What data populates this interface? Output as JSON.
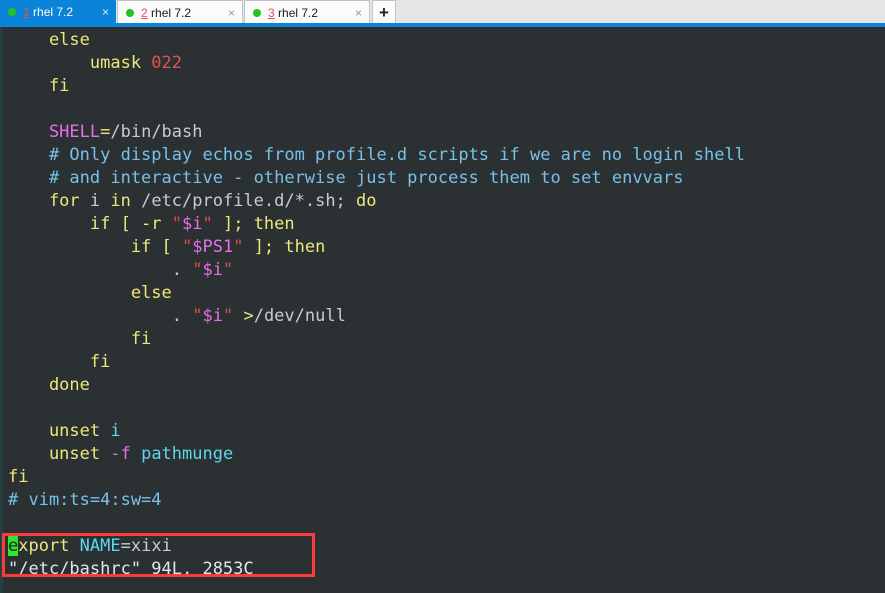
{
  "window": {
    "accent_color": "#0a84d8",
    "tabbar_bg": "#e6e6e6"
  },
  "tabs": {
    "items": [
      {
        "index": "1",
        "title": " rhel 7.2",
        "status_dot": "green-dot-icon",
        "close_label": "×",
        "active": true
      },
      {
        "index": "2",
        "title": " rhel 7.2",
        "status_dot": "green-dot-icon",
        "close_label": "×",
        "active": false
      },
      {
        "index": "3",
        "title": " rhel 7.2",
        "status_dot": "green-dot-icon",
        "close_label": "×",
        "active": false
      }
    ],
    "new_tab_label": "+"
  },
  "terminal": {
    "background": "#2b3033",
    "cursor_color": "#2ee62e",
    "file": "/etc/bashrc",
    "lines": [
      {
        "id": "l01",
        "segs": [
          {
            "t": "    else",
            "c": "kw"
          }
        ]
      },
      {
        "id": "l02",
        "segs": [
          {
            "t": "        umask ",
            "c": "kw"
          },
          {
            "t": "022",
            "c": "num"
          }
        ]
      },
      {
        "id": "l03",
        "segs": [
          {
            "t": "    fi",
            "c": "kw"
          }
        ]
      },
      {
        "id": "l04",
        "segs": [
          {
            "t": "",
            "c": "txt"
          }
        ]
      },
      {
        "id": "l05",
        "segs": [
          {
            "t": "    SHELL",
            "c": "var"
          },
          {
            "t": "=",
            "c": "op"
          },
          {
            "t": "/bin/bash",
            "c": "txt"
          }
        ]
      },
      {
        "id": "l06",
        "segs": [
          {
            "t": "    # Only display echos from profile.d scripts if we are no login shell",
            "c": "cmt"
          }
        ]
      },
      {
        "id": "l07",
        "segs": [
          {
            "t": "    # and interactive - otherwise just process them to set envvars",
            "c": "cmt"
          }
        ]
      },
      {
        "id": "l08",
        "segs": [
          {
            "t": "    for ",
            "c": "kw"
          },
          {
            "t": "i ",
            "c": "txt"
          },
          {
            "t": "in ",
            "c": "kw"
          },
          {
            "t": "/etc/profile.d/*.sh; ",
            "c": "txt"
          },
          {
            "t": "do",
            "c": "kw"
          }
        ]
      },
      {
        "id": "l09",
        "segs": [
          {
            "t": "        if [ -r ",
            "c": "kw"
          },
          {
            "t": "\"",
            "c": "str"
          },
          {
            "t": "$i",
            "c": "var"
          },
          {
            "t": "\"",
            "c": "str"
          },
          {
            "t": " ]; then",
            "c": "kw"
          }
        ]
      },
      {
        "id": "l10",
        "segs": [
          {
            "t": "            if [ ",
            "c": "kw"
          },
          {
            "t": "\"",
            "c": "str"
          },
          {
            "t": "$PS1",
            "c": "var"
          },
          {
            "t": "\"",
            "c": "str"
          },
          {
            "t": " ]; then",
            "c": "kw"
          }
        ]
      },
      {
        "id": "l11",
        "segs": [
          {
            "t": "                . ",
            "c": "txt"
          },
          {
            "t": "\"",
            "c": "str"
          },
          {
            "t": "$i",
            "c": "var"
          },
          {
            "t": "\"",
            "c": "str"
          }
        ]
      },
      {
        "id": "l12",
        "segs": [
          {
            "t": "            else",
            "c": "kw"
          }
        ]
      },
      {
        "id": "l13",
        "segs": [
          {
            "t": "                . ",
            "c": "txt"
          },
          {
            "t": "\"",
            "c": "str"
          },
          {
            "t": "$i",
            "c": "var"
          },
          {
            "t": "\"",
            "c": "str"
          },
          {
            "t": " >",
            "c": "op"
          },
          {
            "t": "/dev/null",
            "c": "txt"
          }
        ]
      },
      {
        "id": "l14",
        "segs": [
          {
            "t": "            fi",
            "c": "kw"
          }
        ]
      },
      {
        "id": "l15",
        "segs": [
          {
            "t": "        fi",
            "c": "kw"
          }
        ]
      },
      {
        "id": "l16",
        "segs": [
          {
            "t": "    done",
            "c": "kw"
          }
        ]
      },
      {
        "id": "l17",
        "segs": [
          {
            "t": "",
            "c": "txt"
          }
        ]
      },
      {
        "id": "l18",
        "segs": [
          {
            "t": "    unset ",
            "c": "kw"
          },
          {
            "t": "i",
            "c": "idn"
          }
        ]
      },
      {
        "id": "l19",
        "segs": [
          {
            "t": "    unset ",
            "c": "kw"
          },
          {
            "t": "-f ",
            "c": "var"
          },
          {
            "t": "pathmunge",
            "c": "idn"
          }
        ]
      },
      {
        "id": "l20",
        "segs": [
          {
            "t": "fi",
            "c": "kw"
          }
        ]
      },
      {
        "id": "l21",
        "segs": [
          {
            "t": "# vim:ts=4:sw=4",
            "c": "cmt"
          }
        ]
      },
      {
        "id": "l22",
        "segs": [
          {
            "t": "",
            "c": "txt"
          }
        ]
      },
      {
        "id": "l23",
        "cursor_char": "e",
        "segs": [
          {
            "t": "xport ",
            "c": "kw"
          },
          {
            "t": "NAME",
            "c": "idn"
          },
          {
            "t": "=xixi",
            "c": "txt"
          }
        ]
      },
      {
        "id": "l24",
        "segs": [
          {
            "t": "\"/etc/bashrc\" 94L, 2853C",
            "c": "wht"
          }
        ]
      }
    ]
  },
  "annotation": {
    "type": "red-rectangle-highlight",
    "color": "#fb3b3b",
    "covers": "export NAME=xixi and status line"
  }
}
